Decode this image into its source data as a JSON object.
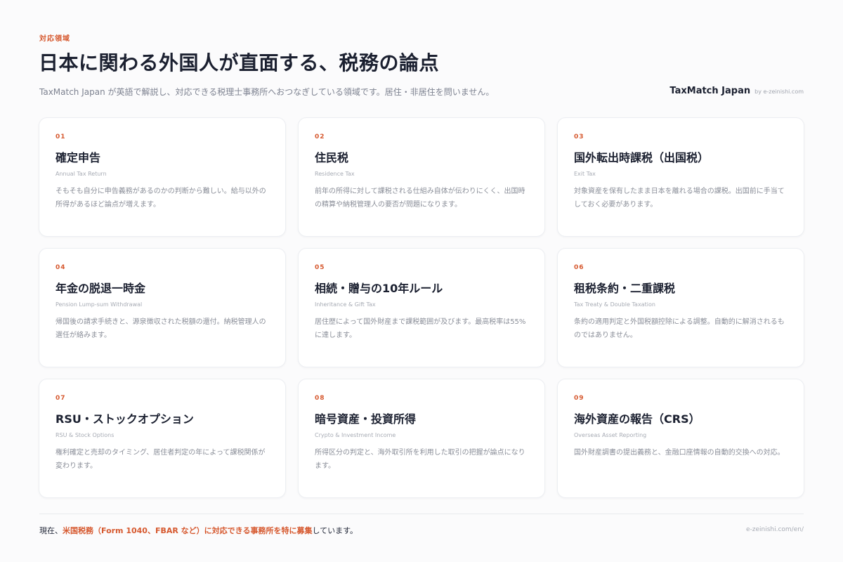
{
  "header": {
    "eyebrow": "対応領域",
    "title": "日本に関わる外国人が直面する、税務の論点",
    "subtitle": "TaxMatch Japan が英語で解説し、対応できる税理士事務所へおつなぎしている領域です。居住・非居住を問いません。",
    "brand_name": "TaxMatch Japan",
    "brand_by": "by e-zeinishi.com"
  },
  "cards": [
    {
      "num": "01",
      "title": "確定申告",
      "en": "Annual Tax Return",
      "desc": "そもそも自分に申告義務があるのかの判断から難しい。給与以外の所得があるほど論点が増えます。"
    },
    {
      "num": "02",
      "title": "住民税",
      "en": "Residence Tax",
      "desc": "前年の所得に対して課税される仕組み自体が伝わりにくく、出国時の精算や納税管理人の要否が問題になります。"
    },
    {
      "num": "03",
      "title": "国外転出時課税（出国税）",
      "en": "Exit Tax",
      "desc": "対象資産を保有したまま日本を離れる場合の課税。出国前に手当てしておく必要があります。"
    },
    {
      "num": "04",
      "title": "年金の脱退一時金",
      "en": "Pension Lump-sum Withdrawal",
      "desc": "帰国後の請求手続きと、源泉徴収された税額の還付。納税管理人の選任が絡みます。"
    },
    {
      "num": "05",
      "title": "相続・贈与の10年ルール",
      "en": "Inheritance & Gift Tax",
      "desc": "居住歴によって国外財産まで課税範囲が及びます。最高税率は55%に達します。"
    },
    {
      "num": "06",
      "title": "租税条約・二重課税",
      "en": "Tax Treaty & Double Taxation",
      "desc": "条約の適用判定と外国税額控除による調整。自動的に解消されるものではありません。"
    },
    {
      "num": "07",
      "title": "RSU・ストックオプション",
      "en": "RSU & Stock Options",
      "desc": "権利確定と売却のタイミング、居住者判定の年によって課税関係が変わります。"
    },
    {
      "num": "08",
      "title": "暗号資産・投資所得",
      "en": "Crypto & Investment Income",
      "desc": "所得区分の判定と、海外取引所を利用した取引の把握が論点になります。"
    },
    {
      "num": "09",
      "title": "海外資産の報告（CRS）",
      "en": "Overseas Asset Reporting",
      "desc": "国外財産調書の提出義務と、金融口座情報の自動的交換への対応。"
    }
  ],
  "footer": {
    "prefix": "現在、",
    "highlight": "米国税務（Form 1040、FBAR など）に対応できる事務所を特に募集",
    "suffix": "しています。",
    "url": "e-zeinishi.com/en/"
  },
  "colors": {
    "accent": "#d6592f",
    "text": "#1b2030",
    "muted": "#8a8e98",
    "background": "#fbfbfc",
    "card": "#ffffff"
  }
}
